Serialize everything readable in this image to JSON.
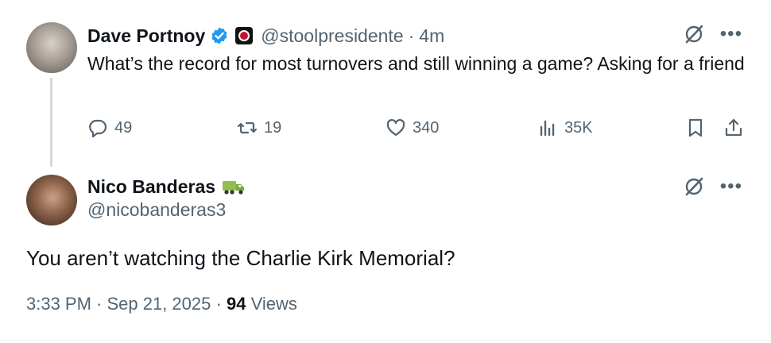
{
  "parent_tweet": {
    "author_name": "Dave Portnoy",
    "handle": "@stoolpresidente",
    "separator": "·",
    "time": "4m",
    "text": "What’s the record for most turnovers and still winning a game?  Asking for a friend",
    "stats": {
      "replies": "49",
      "retweets": "19",
      "likes": "340",
      "views": "35K"
    },
    "verified_color": "#1d9bf0"
  },
  "reply_tweet": {
    "author_name": "Nico Banderas",
    "handle": "@nicobanderas3",
    "text": "You aren’t watching the Charlie Kirk Memorial?",
    "timestamp": "3:33 PM · Sep 21, 2025",
    "separator": "·",
    "views_count": "94",
    "views_label": "Views"
  },
  "icons": {
    "reply": "speech-bubble-icon",
    "retweet": "retweet-icon",
    "like": "heart-icon",
    "views": "bar-chart-icon",
    "bookmark": "bookmark-icon",
    "share": "share-icon",
    "grok": "grok-icon",
    "more": "more-icon"
  },
  "colors": {
    "text_primary": "#0f1419",
    "text_secondary": "#536471",
    "thread_line": "#cfd9de"
  }
}
